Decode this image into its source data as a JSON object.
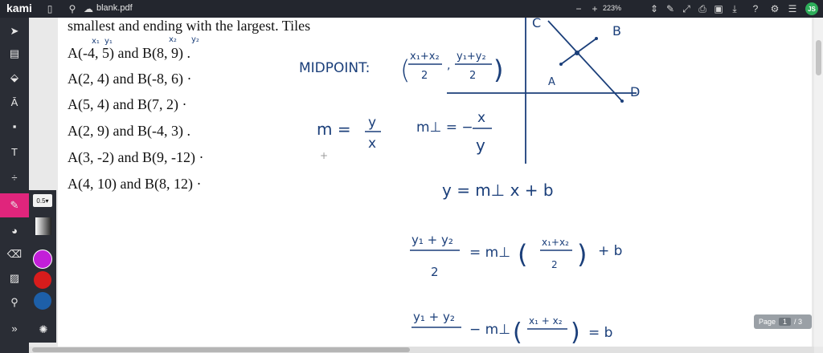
{
  "app": {
    "logo": "kami",
    "filename": "blank.pdf",
    "zoom": "223%",
    "zoom_minus": "−",
    "zoom_plus": "+",
    "user_initials": "JS",
    "avatar_color": "#2eae5a",
    "accent_color": "#e0257c"
  },
  "toolbar": {
    "tools": [
      "cursor-icon",
      "book-icon",
      "stamp-icon",
      "text-highlight-icon",
      "comment-icon",
      "text-icon",
      "divide-icon",
      "pen-icon",
      "shapes-icon",
      "eraser-icon",
      "image-icon",
      "drawing-pin-icon",
      "more-icon",
      "palette-icon"
    ],
    "text_tool_label": "T",
    "divide_label": "÷",
    "more_label": "»",
    "active_tool": "pen-icon",
    "pen_size": "0.5",
    "colors": [
      "#c21fd8",
      "#d81c1c",
      "#1d5fa8"
    ]
  },
  "document": {
    "lines": [
      "smallest and ending with the largest. Tiles",
      "A(-4, 5) and B(8, 9) .",
      "A(2, 4) and B(-8, 6) ·",
      "A(5, 4) and B(7, 2) ·",
      "A(2, 9) and B(-4, 3) .",
      "A(3, -2) and B(9, -12) ·",
      "A(4, 10) and B(8, 12) ·"
    ]
  },
  "handwriting": {
    "label_x1": "x₁",
    "label_y1": "y₁",
    "label_x2": "x₂",
    "label_y2": "y₂",
    "midpoint_label": "MIDPOINT:",
    "midpoint_formula_top_1": "x₁+x₂",
    "midpoint_formula_bottom_1": "2",
    "midpoint_formula_top_2": "y₁+y₂",
    "midpoint_formula_bottom_2": "2",
    "slope": "m =",
    "slope_y": "y",
    "slope_x": "x",
    "perp_slope": "m⊥ = −",
    "perp_x": "x",
    "perp_y": "y",
    "line_eq": "y = m⊥ x + b",
    "eq2_top": "y₁ + y₂",
    "eq2_bottom": "2",
    "eq2_mid": "= m⊥",
    "eq2_frac_top": "x₁+x₂",
    "eq2_frac_bottom": "2",
    "eq2_tail": "+ b",
    "eq3_top": "y₁ + y₂",
    "eq3_mid": "− m⊥",
    "eq3_frac_top": "x₁ + x₂",
    "eq3_tail": "= b",
    "point_c": "C",
    "point_b": "B",
    "point_a": "A",
    "point_d": "D"
  },
  "pagination": {
    "label": "Page",
    "current": "1",
    "total": "/ 3"
  }
}
